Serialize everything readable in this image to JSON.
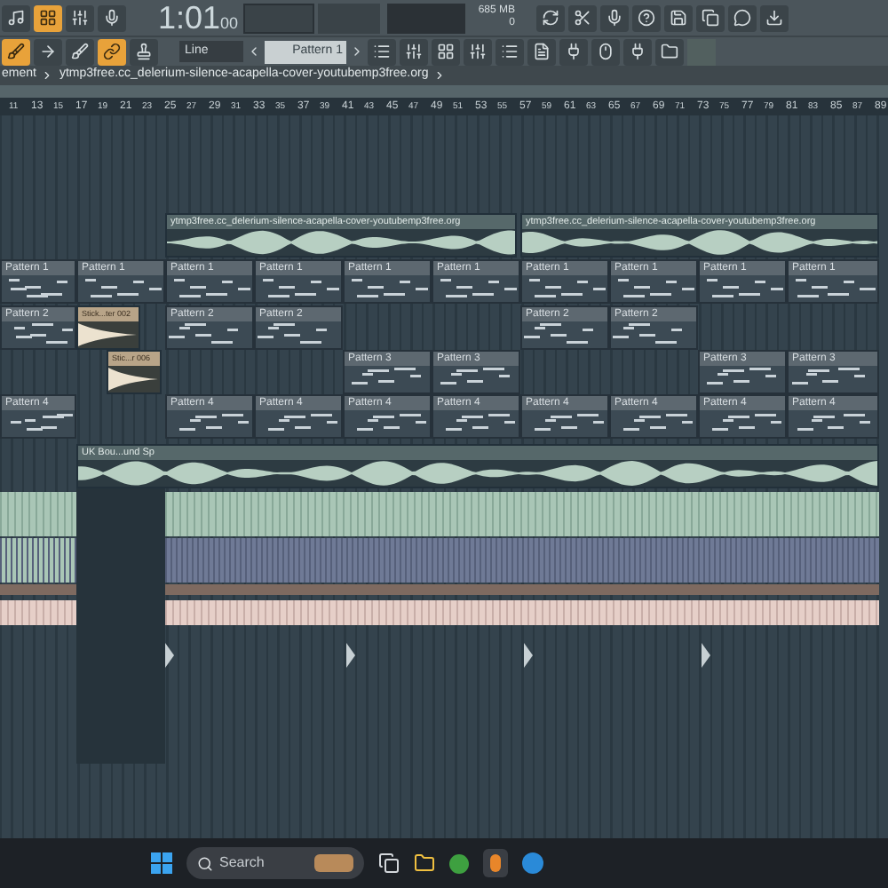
{
  "toolbar": {
    "time": "1:01",
    "time_sub": "00",
    "memory": "685 MB",
    "cpu": "0",
    "snap": "Line",
    "pattern": "Pattern 1",
    "snap_toggle_on": true,
    "link_toggle_on": true
  },
  "breadcrumb": {
    "parent": "ement",
    "file": "ytmp3free.cc_delerium-silence-acapella-cover-youtubemp3free.org"
  },
  "ruler": [
    "11",
    "13",
    "15",
    "17",
    "19",
    "21",
    "23",
    "25",
    "27",
    "29",
    "31",
    "33",
    "35",
    "37",
    "39",
    "41",
    "43",
    "45",
    "47",
    "49",
    "51",
    "53",
    "55",
    "57",
    "59",
    "61",
    "63",
    "65",
    "67",
    "69",
    "71",
    "73",
    "75",
    "77",
    "79",
    "81",
    "83",
    "85",
    "87",
    "89"
  ],
  "lanes": [
    {
      "clips": [
        {
          "kind": "audio",
          "label": "ytmp3free.cc_delerium-silence-acapella-cover-youtubemp3free.org"
        },
        {
          "kind": "audio",
          "label": "ytmp3free.cc_delerium-silence-acapella-cover-youtubemp3free.org"
        }
      ]
    },
    {
      "clips": [
        {
          "kind": "pattern",
          "label": "Pattern 1"
        },
        {
          "kind": "pattern",
          "label": "Pattern 1"
        },
        {
          "kind": "pattern",
          "label": "Pattern 1"
        },
        {
          "kind": "pattern",
          "label": "Pattern 1"
        },
        {
          "kind": "pattern",
          "label": "Pattern 1"
        },
        {
          "kind": "pattern",
          "label": "Pattern 1"
        },
        {
          "kind": "pattern",
          "label": "Pattern 1"
        },
        {
          "kind": "pattern",
          "label": "Pattern 1"
        },
        {
          "kind": "pattern",
          "label": "Pattern 1"
        },
        {
          "kind": "pattern",
          "label": "Pattern 1"
        }
      ]
    },
    {
      "clips": [
        {
          "kind": "pattern",
          "label": "Pattern 2"
        },
        {
          "kind": "sample",
          "label": "Stick...ter 002"
        },
        {
          "kind": "pattern",
          "label": "Pattern 2"
        },
        {
          "kind": "pattern",
          "label": "Pattern 2"
        },
        {
          "kind": "pattern",
          "label": "Pattern 2"
        },
        {
          "kind": "pattern",
          "label": "Pattern 2"
        }
      ]
    },
    {
      "clips": [
        {
          "kind": "sample",
          "label": "Stic...r 006"
        },
        {
          "kind": "pattern",
          "label": "Pattern 3"
        },
        {
          "kind": "pattern",
          "label": "Pattern 3"
        },
        {
          "kind": "pattern",
          "label": "Pattern 3"
        },
        {
          "kind": "pattern",
          "label": "Pattern 3"
        }
      ]
    },
    {
      "clips": [
        {
          "kind": "pattern",
          "label": "Pattern 4"
        },
        {
          "kind": "pattern",
          "label": "Pattern 4"
        },
        {
          "kind": "pattern",
          "label": "Pattern 4"
        },
        {
          "kind": "pattern",
          "label": "Pattern 4"
        },
        {
          "kind": "pattern",
          "label": "Pattern 4"
        },
        {
          "kind": "pattern",
          "label": "Pattern 4"
        },
        {
          "kind": "pattern",
          "label": "Pattern 4"
        },
        {
          "kind": "pattern",
          "label": "Pattern 4"
        },
        {
          "kind": "pattern",
          "label": "Pattern 4"
        }
      ]
    },
    {
      "clips": [
        {
          "kind": "audio",
          "label": "UK Bou...und Sp"
        }
      ]
    }
  ],
  "taskbar": {
    "search_placeholder": "Search"
  }
}
